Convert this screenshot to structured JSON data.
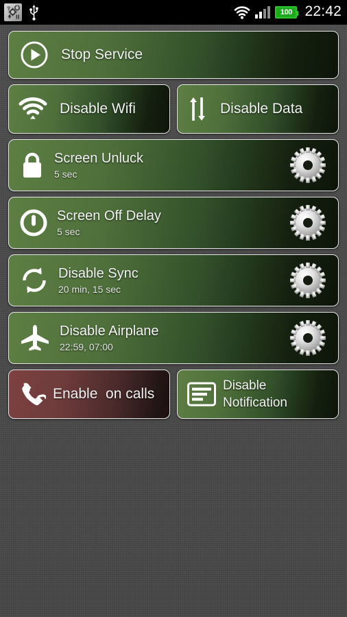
{
  "status_bar": {
    "app_notification_icon": "app-settings-notification-icon",
    "usb_icon": "usb-icon",
    "wifi_icon": "wifi-icon",
    "signal_icon": "signal-bars-icon",
    "signal_bars_filled": 2,
    "signal_bars_total": 4,
    "battery_level": "100",
    "clock": "22:42"
  },
  "colors": {
    "background": "#4a4a4a",
    "button_green_light": "#5d7f44",
    "button_green_dark": "#0d1509",
    "button_red_light": "#7d4141",
    "button_red_dark": "#1b1010",
    "button_border": "#e8e8e8",
    "battery_green": "#2fc22f",
    "text_primary": "#f4f4f4"
  },
  "main": {
    "service_button": {
      "label": "Stop Service",
      "icon": "play-circle-icon"
    },
    "toggles_row": [
      {
        "label": "Disable Wifi",
        "icon": "wifi-icon"
      },
      {
        "label": "Disable Data",
        "icon": "data-transfer-arrows-icon"
      }
    ],
    "settings_rows": [
      {
        "title": "Screen Unluck",
        "subtitle": "5 sec",
        "icon": "lock-icon",
        "action_icon": "gear-icon"
      },
      {
        "title": "Screen Off Delay",
        "subtitle": "5 sec",
        "icon": "power-circle-icon",
        "action_icon": "gear-icon"
      },
      {
        "title": "Disable Sync",
        "subtitle": "20 min, 15 sec",
        "icon": "sync-refresh-icon",
        "action_icon": "gear-icon"
      },
      {
        "title": "Disable Airplane",
        "subtitle": "22:59, 07:00",
        "icon": "airplane-icon",
        "action_icon": "gear-icon"
      }
    ],
    "bottom_row": [
      {
        "label": "Enable  on calls",
        "icon": "phone-handset-icon",
        "variant": "red"
      },
      {
        "label_line1": "Disable",
        "label_line2": "Notification",
        "icon": "notification-list-icon",
        "variant": "green"
      }
    ]
  }
}
